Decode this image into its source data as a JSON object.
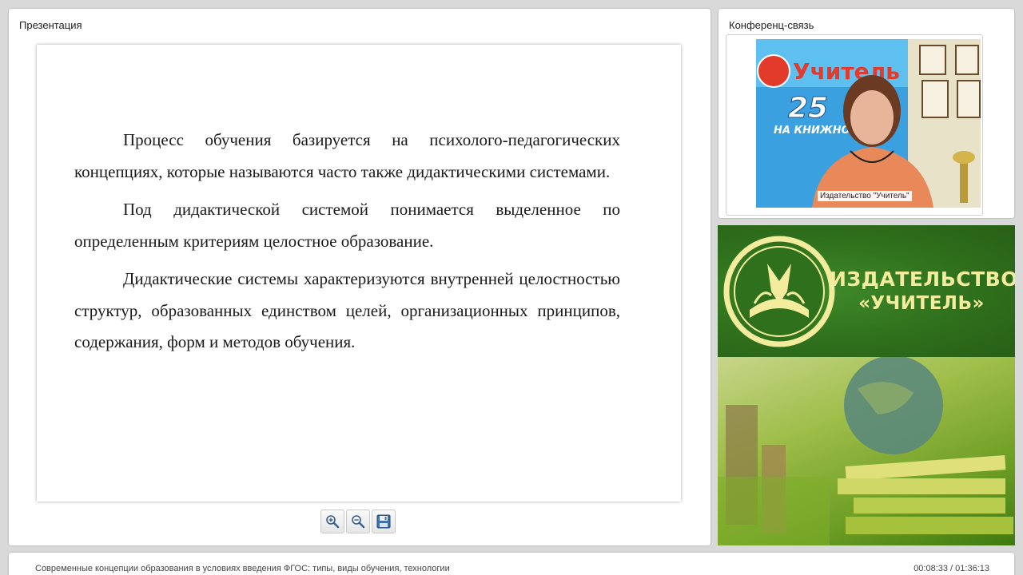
{
  "presentation": {
    "title": "Презентация",
    "slide": {
      "paragraphs": [
        "Процесс обучения базируется на психолого-педагогических концепциях, которые называются часто также дидактическими системами.",
        "Под дидактической системой понимается выделенное по определенным критериям целостное образование.",
        "Дидактические системы характеризуются внутренней целостностью структур, образованных единством целей, организационных принципов, содержания, форм и методов обучения."
      ]
    },
    "toolbar": {
      "zoom_in_icon": "zoom-in-icon",
      "zoom_out_icon": "zoom-out-icon",
      "save_icon": "floppy-disk-icon"
    }
  },
  "conference": {
    "title": "Конференц-связь",
    "video_caption": "Издательство \"Учитель\"",
    "video_overlay": {
      "brand": "Учитель",
      "years": "25",
      "line": "НА КНИЖНОМ"
    }
  },
  "banner": {
    "line1": "ИЗДАТЕЛЬСТВО",
    "line2": "«УЧИТЕЛЬ»",
    "colors": {
      "green": "#2f701c",
      "gold": "#f2ec9c"
    }
  },
  "status": {
    "lecture_title": "Современные концепции образования в условиях введения ФГОС: типы, виды обучения, технологии",
    "time": "00:08:33 / 01:36:13"
  }
}
